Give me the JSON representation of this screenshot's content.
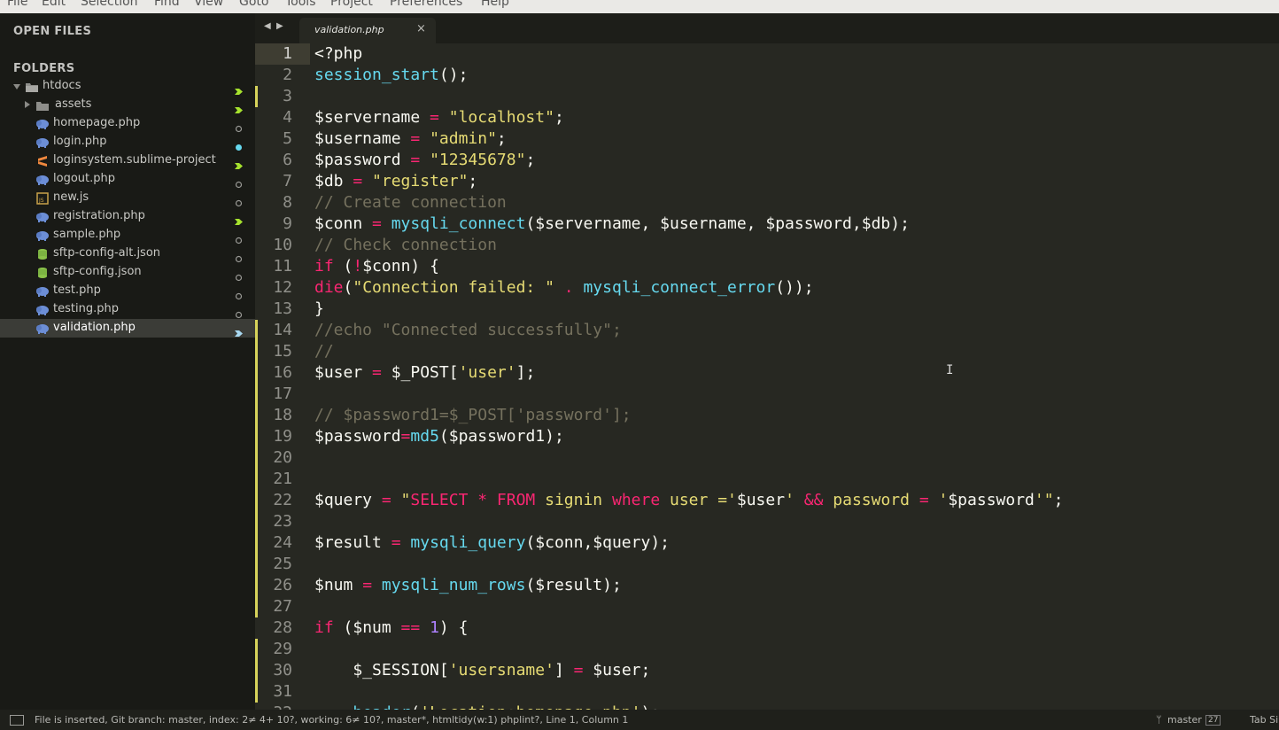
{
  "menu": [
    "File",
    "Edit",
    "Selection",
    "Find",
    "View",
    "Goto",
    "Tools",
    "Project",
    "Preferences",
    "Help"
  ],
  "sidebar": {
    "open_files_label": "OPEN FILES",
    "folders_label": "FOLDERS",
    "items": [
      {
        "label": "htdocs",
        "icon": "folder-open-icon",
        "status": "modified"
      },
      {
        "label": "assets",
        "icon": "folder-icon",
        "status": "modified"
      },
      {
        "label": "homepage.php",
        "icon": "php-elephant-icon",
        "status": "unchanged"
      },
      {
        "label": "login.php",
        "icon": "php-elephant-icon",
        "status": "staged"
      },
      {
        "label": "loginsystem.sublime-project",
        "icon": "sublime-project-icon",
        "status": "modified"
      },
      {
        "label": "logout.php",
        "icon": "php-elephant-icon",
        "status": "unchanged"
      },
      {
        "label": "new.js",
        "icon": "js-file-icon",
        "status": "unchanged"
      },
      {
        "label": "registration.php",
        "icon": "php-elephant-icon",
        "status": "modified"
      },
      {
        "label": "sample.php",
        "icon": "php-elephant-icon",
        "status": "unchanged"
      },
      {
        "label": "sftp-config-alt.json",
        "icon": "json-file-icon",
        "status": "unchanged"
      },
      {
        "label": "sftp-config.json",
        "icon": "json-file-icon",
        "status": "unchanged"
      },
      {
        "label": "test.php",
        "icon": "php-elephant-icon",
        "status": "unchanged"
      },
      {
        "label": "testing.php",
        "icon": "php-elephant-icon",
        "status": "unchanged"
      },
      {
        "label": "validation.php",
        "icon": "php-elephant-icon",
        "status": "modified-active"
      }
    ]
  },
  "tab": {
    "label": "validation.php",
    "close": "×"
  },
  "colors": {
    "keyword": "#f92672",
    "string": "#e6db74",
    "function": "#66d9ef",
    "comment": "#75715e",
    "number": "#ae81ff",
    "git_modified": "#a6e22e",
    "git_staged": "#66d9ef",
    "gutter_mark": "#d6d25a"
  },
  "editor": {
    "current_line": 1,
    "lines": [
      [
        [
          "p",
          "<?php"
        ]
      ],
      [
        [
          "f",
          "session_start"
        ],
        [
          "p",
          "();"
        ]
      ],
      [],
      [
        [
          "p",
          "$servername "
        ],
        [
          "k",
          "="
        ],
        [
          "p",
          " "
        ],
        [
          "s",
          "\"localhost\""
        ],
        [
          "p",
          ";"
        ]
      ],
      [
        [
          "p",
          "$username "
        ],
        [
          "k",
          "="
        ],
        [
          "p",
          " "
        ],
        [
          "s",
          "\"admin\""
        ],
        [
          "p",
          ";"
        ]
      ],
      [
        [
          "p",
          "$password "
        ],
        [
          "k",
          "="
        ],
        [
          "p",
          " "
        ],
        [
          "s",
          "\"12345678\""
        ],
        [
          "p",
          ";"
        ]
      ],
      [
        [
          "p",
          "$db "
        ],
        [
          "k",
          "="
        ],
        [
          "p",
          " "
        ],
        [
          "s",
          "\"register\""
        ],
        [
          "p",
          ";"
        ]
      ],
      [
        [
          "c",
          "// Create connection"
        ]
      ],
      [
        [
          "p",
          "$conn "
        ],
        [
          "k",
          "="
        ],
        [
          "p",
          " "
        ],
        [
          "f",
          "mysqli_connect"
        ],
        [
          "p",
          "($servername, $username, $password,$db);"
        ]
      ],
      [
        [
          "c",
          "// Check connection"
        ]
      ],
      [
        [
          "k",
          "if"
        ],
        [
          "p",
          " ("
        ],
        [
          "k",
          "!"
        ],
        [
          "p",
          "$conn) {"
        ]
      ],
      [
        [
          "k",
          "die"
        ],
        [
          "p",
          "("
        ],
        [
          "s",
          "\"Connection failed: \""
        ],
        [
          "p",
          " "
        ],
        [
          "k",
          "."
        ],
        [
          "p",
          " "
        ],
        [
          "f",
          "mysqli_connect_error"
        ],
        [
          "p",
          "());"
        ]
      ],
      [
        [
          "p",
          "}"
        ]
      ],
      [
        [
          "c",
          "//echo \"Connected successfully\";"
        ]
      ],
      [
        [
          "c",
          "//"
        ]
      ],
      [
        [
          "p",
          "$user "
        ],
        [
          "k",
          "="
        ],
        [
          "p",
          " $_POST["
        ],
        [
          "s",
          "'user'"
        ],
        [
          "p",
          "];"
        ]
      ],
      [],
      [
        [
          "c",
          "// $password1=$_POST['password'];"
        ]
      ],
      [
        [
          "p",
          "$password"
        ],
        [
          "k",
          "="
        ],
        [
          "f",
          "md5"
        ],
        [
          "p",
          "($password1);"
        ]
      ],
      [],
      [],
      [
        [
          "p",
          "$query "
        ],
        [
          "k",
          "="
        ],
        [
          "p",
          " "
        ],
        [
          "s",
          "\""
        ],
        [
          "k",
          "SELECT * FROM"
        ],
        [
          "s",
          " signin "
        ],
        [
          "k",
          "where"
        ],
        [
          "s",
          " user ='"
        ],
        [
          "p",
          "$user"
        ],
        [
          "s",
          "' "
        ],
        [
          "k",
          "&&"
        ],
        [
          "s",
          " password "
        ],
        [
          "k",
          "="
        ],
        [
          "s",
          " '"
        ],
        [
          "p",
          "$password"
        ],
        [
          "s",
          "'\""
        ],
        [
          "p",
          ";"
        ]
      ],
      [],
      [
        [
          "p",
          "$result "
        ],
        [
          "k",
          "="
        ],
        [
          "p",
          " "
        ],
        [
          "f",
          "mysqli_query"
        ],
        [
          "p",
          "($conn,$query);"
        ]
      ],
      [],
      [
        [
          "p",
          "$num "
        ],
        [
          "k",
          "="
        ],
        [
          "p",
          " "
        ],
        [
          "f",
          "mysqli_num_rows"
        ],
        [
          "p",
          "($result);"
        ]
      ],
      [],
      [
        [
          "k",
          "if"
        ],
        [
          "p",
          " ($num "
        ],
        [
          "k",
          "=="
        ],
        [
          "p",
          " "
        ],
        [
          "n",
          "1"
        ],
        [
          "p",
          ") {"
        ]
      ],
      [],
      [
        [
          "p",
          "    $_SESSION["
        ],
        [
          "s",
          "'usersname'"
        ],
        [
          "p",
          "] "
        ],
        [
          "k",
          "="
        ],
        [
          "p",
          " $user;"
        ]
      ],
      [],
      [
        [
          "p",
          "    "
        ],
        [
          "f",
          "header"
        ],
        [
          "p",
          "("
        ],
        [
          "s",
          "'Location:homepage.php'"
        ],
        [
          "p",
          ");"
        ]
      ]
    ]
  },
  "status": {
    "text": "File is inserted, Git branch: master, index: 2≠ 4+ 10?, working: 6≠ 10?, master*, htmltidy(w:1) phplint?, Line 1, Column 1",
    "branch": "master",
    "branch_count": "27",
    "tab_size": "Tab Si"
  }
}
